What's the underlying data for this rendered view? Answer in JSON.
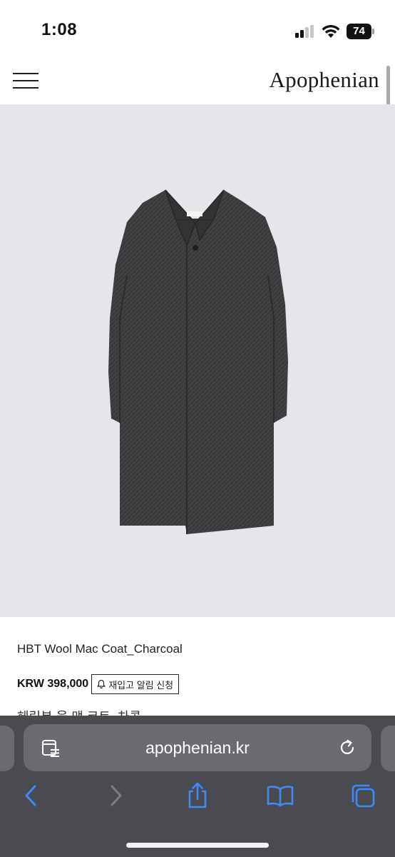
{
  "status_bar": {
    "time": "1:08",
    "battery_level": "74",
    "signal_bars_active": 2,
    "signal_bars_total": 4
  },
  "header": {
    "brand": "Apophenian",
    "menu_icon": "hamburger-menu-icon"
  },
  "product": {
    "image_alt_subject": "charcoal wool mac coat",
    "name": "HBT Wool Mac Coat_Charcoal",
    "price": "KRW 398,000",
    "restock_button_label": "재입고 알림 신청",
    "restock_icon": "bell-icon",
    "korean_name": "헤링본 울 맥 코트_차콜"
  },
  "browser": {
    "url": "apophenian.kr",
    "reader_icon": "page-menu-icon",
    "reload_icon": "reload-icon",
    "toolbar": {
      "back_icon": "chevron-left-icon",
      "forward_icon": "chevron-right-icon",
      "share_icon": "share-icon",
      "bookmarks_icon": "book-icon",
      "tabs_icon": "tabs-icon"
    },
    "colors": {
      "toolbar_bg": "#4a4b50",
      "address_bg": "#6a6b70",
      "active_icon": "#3d8cf5",
      "disabled_icon": "#7d7e83"
    }
  },
  "colors": {
    "image_bg": "#e6e5e9",
    "coat": "#3a3a3c"
  }
}
